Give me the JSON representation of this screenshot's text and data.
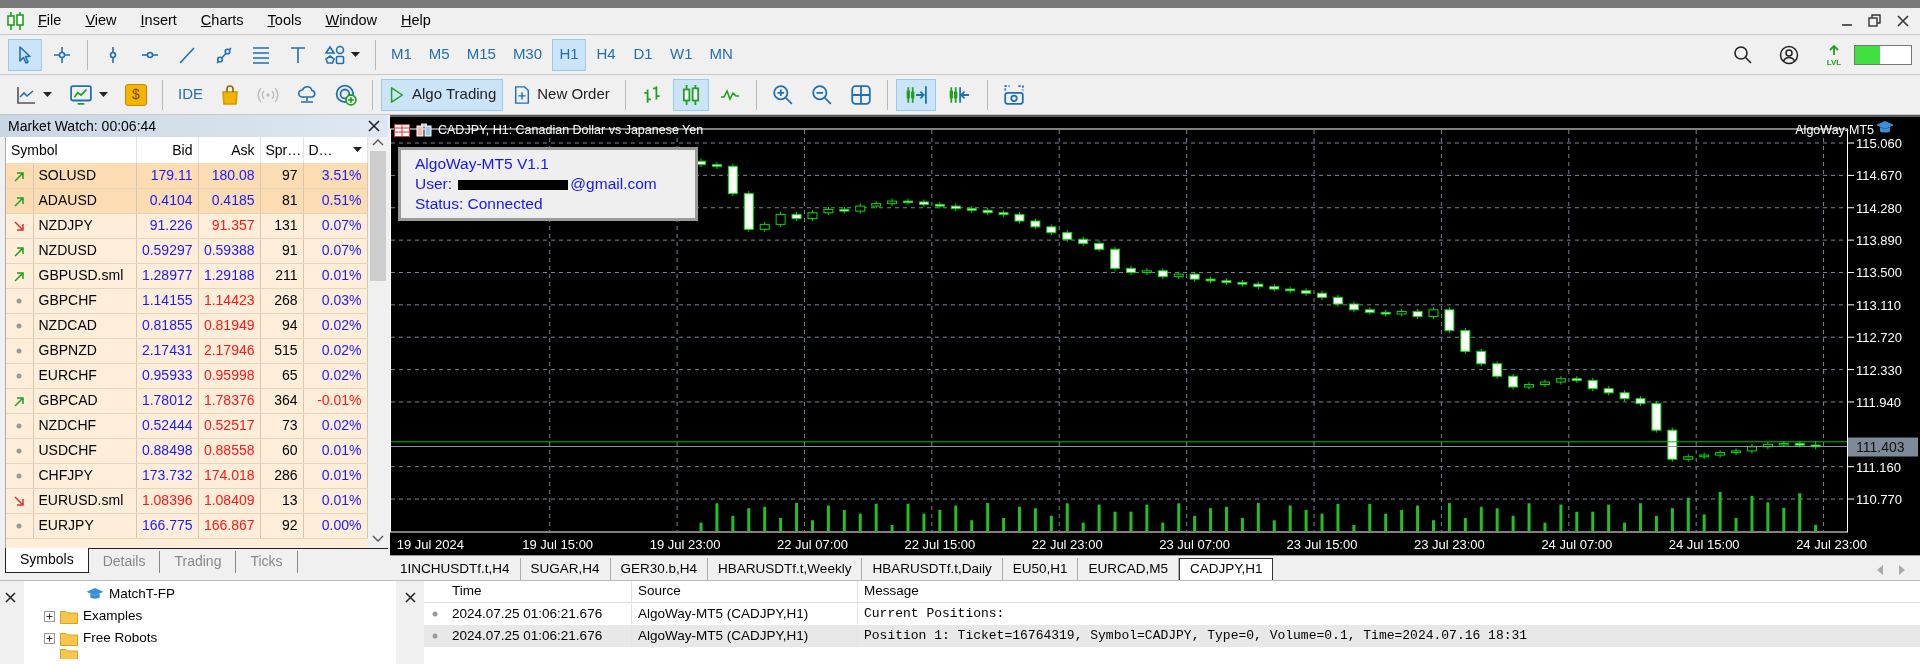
{
  "menu": [
    "File",
    "View",
    "Insert",
    "Charts",
    "Tools",
    "Window",
    "Help"
  ],
  "drawing_tools": [
    {
      "kind": "cursor",
      "selected": true
    },
    {
      "kind": "crosshair",
      "selected": false
    },
    {
      "kind": "vline",
      "selected": false
    },
    {
      "kind": "hline",
      "selected": false
    },
    {
      "kind": "trend",
      "selected": false
    },
    {
      "kind": "points",
      "selected": false
    },
    {
      "kind": "fibo",
      "selected": false
    },
    {
      "kind": "text",
      "selected": false
    },
    {
      "kind": "shapes",
      "selected": false
    }
  ],
  "timeframes": [
    {
      "label": "M1",
      "selected": false
    },
    {
      "label": "M5",
      "selected": false
    },
    {
      "label": "M15",
      "selected": false
    },
    {
      "label": "M30",
      "selected": false
    },
    {
      "label": "H1",
      "selected": true
    },
    {
      "label": "H4",
      "selected": false
    },
    {
      "label": "D1",
      "selected": false
    },
    {
      "label": "W1",
      "selected": false
    },
    {
      "label": "MN",
      "selected": false
    }
  ],
  "toolbar": [
    [
      {
        "kind": "linechart",
        "selected": false,
        "disabled": false
      },
      {
        "kind": "chartwin",
        "selected": false,
        "disabled": false
      },
      {
        "kind": "dollar",
        "label": "$",
        "selected": false,
        "disabled": false
      }
    ],
    [
      {
        "kind": "ide",
        "label": "IDE",
        "selected": false,
        "disabled": false
      },
      {
        "kind": "bag",
        "selected": false,
        "disabled": false
      },
      {
        "kind": "signal",
        "selected": false,
        "disabled": true
      },
      {
        "kind": "cloud",
        "selected": false,
        "disabled": false
      },
      {
        "kind": "globe",
        "selected": false,
        "disabled": false
      }
    ],
    [
      {
        "kind": "algo",
        "label": "Algo Trading",
        "selected": true,
        "disabled": false
      },
      {
        "kind": "order",
        "label": "New Order",
        "selected": false,
        "disabled": false
      }
    ],
    [
      {
        "kind": "bars",
        "selected": false,
        "disabled": false
      },
      {
        "kind": "candles",
        "selected": true,
        "disabled": false
      },
      {
        "kind": "line",
        "selected": false,
        "disabled": false
      }
    ],
    [
      {
        "kind": "zoomin",
        "selected": false,
        "disabled": false
      },
      {
        "kind": "zoomout",
        "selected": false,
        "disabled": false
      },
      {
        "kind": "grid",
        "selected": false,
        "disabled": false
      }
    ],
    [
      {
        "kind": "autoscroll",
        "selected": true,
        "disabled": false
      },
      {
        "kind": "shift",
        "selected": false,
        "disabled": false
      }
    ],
    [
      {
        "kind": "screenshot",
        "selected": false,
        "disabled": false
      }
    ]
  ],
  "level_meter": {
    "label": "LVL",
    "level": 0.45
  },
  "market_watch": {
    "title": "Market Watch: 00:06:44",
    "columns": [
      "Symbol",
      "Bid",
      "Ask",
      "Spr…",
      "D…"
    ],
    "rows": [
      {
        "kind": "up",
        "symbol": "SOLUSD",
        "bid": "179.11",
        "ask": "180.08",
        "spread": "97",
        "change": "3.51%",
        "bid_down": false,
        "ask_down": false,
        "change_negative": false,
        "highlighted": true
      },
      {
        "kind": "up",
        "symbol": "ADAUSD",
        "bid": "0.4104",
        "ask": "0.4185",
        "spread": "81",
        "change": "0.51%",
        "bid_down": false,
        "ask_down": false,
        "change_negative": false,
        "highlighted": true
      },
      {
        "kind": "down",
        "symbol": "NZDJPY",
        "bid": "91.226",
        "ask": "91.357",
        "spread": "131",
        "change": "0.07%",
        "bid_down": false,
        "ask_down": true,
        "change_negative": false,
        "highlighted": false
      },
      {
        "kind": "up",
        "symbol": "NZDUSD",
        "bid": "0.59297",
        "ask": "0.59388",
        "spread": "91",
        "change": "0.07%",
        "bid_down": false,
        "ask_down": false,
        "change_negative": false,
        "highlighted": false
      },
      {
        "kind": "up",
        "symbol": "GBPUSD.sml",
        "bid": "1.28977",
        "ask": "1.29188",
        "spread": "211",
        "change": "0.01%",
        "bid_down": false,
        "ask_down": false,
        "change_negative": false,
        "highlighted": false
      },
      {
        "kind": "flat",
        "symbol": "GBPCHF",
        "bid": "1.14155",
        "ask": "1.14423",
        "spread": "268",
        "change": "0.03%",
        "bid_down": false,
        "ask_down": true,
        "change_negative": false,
        "highlighted": false
      },
      {
        "kind": "flat",
        "symbol": "NZDCAD",
        "bid": "0.81855",
        "ask": "0.81949",
        "spread": "94",
        "change": "0.02%",
        "bid_down": false,
        "ask_down": true,
        "change_negative": false,
        "highlighted": false
      },
      {
        "kind": "flat",
        "symbol": "GBPNZD",
        "bid": "2.17431",
        "ask": "2.17946",
        "spread": "515",
        "change": "0.02%",
        "bid_down": false,
        "ask_down": true,
        "change_negative": false,
        "highlighted": false
      },
      {
        "kind": "flat",
        "symbol": "EURCHF",
        "bid": "0.95933",
        "ask": "0.95998",
        "spread": "65",
        "change": "0.02%",
        "bid_down": false,
        "ask_down": true,
        "change_negative": false,
        "highlighted": false
      },
      {
        "kind": "up",
        "symbol": "GBPCAD",
        "bid": "1.78012",
        "ask": "1.78376",
        "spread": "364",
        "change": "-0.01%",
        "bid_down": false,
        "ask_down": true,
        "change_negative": true,
        "highlighted": false
      },
      {
        "kind": "flat",
        "symbol": "NZDCHF",
        "bid": "0.52444",
        "ask": "0.52517",
        "spread": "73",
        "change": "0.02%",
        "bid_down": false,
        "ask_down": true,
        "change_negative": false,
        "highlighted": false
      },
      {
        "kind": "flat",
        "symbol": "USDCHF",
        "bid": "0.88498",
        "ask": "0.88558",
        "spread": "60",
        "change": "0.01%",
        "bid_down": false,
        "ask_down": true,
        "change_negative": false,
        "highlighted": false
      },
      {
        "kind": "flat",
        "symbol": "CHFJPY",
        "bid": "173.732",
        "ask": "174.018",
        "spread": "286",
        "change": "0.01%",
        "bid_down": false,
        "ask_down": true,
        "change_negative": false,
        "highlighted": false
      },
      {
        "kind": "down",
        "symbol": "EURUSD.sml",
        "bid": "1.08396",
        "ask": "1.08409",
        "spread": "13",
        "change": "0.01%",
        "bid_down": true,
        "ask_down": true,
        "change_negative": false,
        "highlighted": false
      },
      {
        "kind": "flat",
        "symbol": "EURJPY",
        "bid": "166.775",
        "ask": "166.867",
        "spread": "92",
        "change": "0.00%",
        "bid_down": false,
        "ask_down": true,
        "change_negative": false,
        "highlighted": false
      }
    ],
    "tabs": [
      {
        "label": "Symbols",
        "selected": true
      },
      {
        "label": "Details",
        "selected": false
      },
      {
        "label": "Trading",
        "selected": false
      },
      {
        "label": "Ticks",
        "selected": false
      }
    ]
  },
  "chart": {
    "header": "CADJPY, H1:  Canadian Dollar vs Japanese Yen",
    "ea_label": "AlgoWay-MT5",
    "info_box": {
      "title": "AlgoWay-MT5 V1.1",
      "user_label": "User:",
      "email_visible": "@gmail.com",
      "status": "Status: Connected"
    },
    "chart_data": {
      "type": "candlestick",
      "categories": [
        "19 Jul 2024",
        null,
        null,
        null,
        null,
        null,
        null,
        null,
        "19 Jul 15:00",
        null,
        null,
        null,
        null,
        null,
        null,
        null,
        "19 Jul 23:00",
        null,
        null,
        null,
        null,
        null,
        null,
        null,
        "22 Jul 07:00",
        null,
        null,
        null,
        null,
        null,
        null,
        null,
        "22 Jul 15:00",
        null,
        null,
        null,
        null,
        null,
        null,
        null,
        "22 Jul 23:00",
        null,
        null,
        null,
        null,
        null,
        null,
        null,
        "23 Jul 07:00",
        null,
        null,
        null,
        null,
        null,
        null,
        null,
        "23 Jul 15:00",
        null,
        null,
        null,
        null,
        null,
        null,
        null,
        "23 Jul 23:00",
        null,
        null,
        null,
        null,
        null,
        null,
        null,
        "24 Jul 07:00",
        null,
        null,
        null,
        null,
        null,
        null,
        null,
        "24 Jul 15:00",
        null,
        null,
        null,
        null,
        null,
        null,
        null,
        "24 Jul 23:00"
      ],
      "ohlc": [
        null,
        null,
        null,
        null,
        null,
        null,
        null,
        null,
        null,
        null,
        null,
        null,
        null,
        null,
        null,
        null,
        null,
        [
          114.84,
          114.87,
          114.77,
          114.8
        ],
        [
          114.8,
          114.83,
          114.75,
          114.78
        ],
        [
          114.78,
          114.81,
          114.42,
          114.45
        ],
        [
          114.45,
          114.48,
          113.99,
          114.02
        ],
        [
          114.02,
          114.11,
          113.99,
          114.08
        ],
        [
          114.08,
          114.23,
          114.05,
          114.2
        ],
        [
          114.2,
          114.23,
          114.12,
          114.15
        ],
        [
          114.15,
          114.25,
          114.12,
          114.22
        ],
        [
          114.22,
          114.29,
          114.19,
          114.26
        ],
        [
          114.26,
          114.29,
          114.21,
          114.24
        ],
        [
          114.24,
          114.33,
          114.21,
          114.3
        ],
        [
          114.3,
          114.36,
          114.27,
          114.33
        ],
        [
          114.33,
          114.39,
          114.3,
          114.36
        ],
        [
          114.36,
          114.39,
          114.32,
          114.35
        ],
        [
          114.35,
          114.38,
          114.29,
          114.32
        ],
        [
          114.32,
          114.35,
          114.27,
          114.3
        ],
        [
          114.3,
          114.33,
          114.24,
          114.27
        ],
        [
          114.27,
          114.3,
          114.22,
          114.25
        ],
        [
          114.25,
          114.28,
          114.19,
          114.22
        ],
        [
          114.22,
          114.25,
          114.17,
          114.2
        ],
        [
          114.2,
          114.23,
          114.09,
          114.12
        ],
        [
          114.12,
          114.15,
          114.02,
          114.05
        ],
        [
          114.05,
          114.08,
          113.95,
          113.98
        ],
        [
          113.98,
          114.01,
          113.87,
          113.9
        ],
        [
          113.9,
          113.93,
          113.82,
          113.85
        ],
        [
          113.85,
          113.88,
          113.75,
          113.78
        ],
        [
          113.78,
          113.81,
          113.52,
          113.55
        ],
        [
          113.55,
          113.58,
          113.47,
          113.5
        ],
        [
          113.5,
          113.55,
          113.47,
          113.52
        ],
        [
          113.52,
          113.55,
          113.42,
          113.45
        ],
        [
          113.45,
          113.51,
          113.42,
          113.48
        ],
        [
          113.48,
          113.51,
          113.39,
          113.42
        ],
        [
          113.42,
          113.45,
          113.37,
          113.4
        ],
        [
          113.4,
          113.43,
          113.35,
          113.38
        ],
        [
          113.38,
          113.41,
          113.33,
          113.36
        ],
        [
          113.36,
          113.39,
          113.3,
          113.33
        ],
        [
          113.33,
          113.36,
          113.27,
          113.3
        ],
        [
          113.3,
          113.33,
          113.25,
          113.28
        ],
        [
          113.28,
          113.31,
          113.22,
          113.25
        ],
        [
          113.25,
          113.28,
          113.17,
          113.2
        ],
        [
          113.2,
          113.23,
          113.09,
          113.12
        ],
        [
          113.12,
          113.15,
          113.02,
          113.05
        ],
        [
          113.05,
          113.08,
          112.99,
          113.02
        ],
        [
          113.02,
          113.05,
          112.97,
          113.0
        ],
        [
          113.0,
          113.06,
          112.97,
          113.03
        ],
        [
          113.03,
          113.06,
          112.94,
          112.97
        ],
        [
          112.97,
          113.08,
          112.94,
          113.05
        ],
        [
          113.05,
          113.08,
          112.77,
          112.8
        ],
        [
          112.8,
          112.83,
          112.52,
          112.55
        ],
        [
          112.55,
          112.58,
          112.37,
          112.4
        ],
        [
          112.4,
          112.43,
          112.22,
          112.25
        ],
        [
          112.25,
          112.28,
          112.09,
          112.12
        ],
        [
          112.12,
          112.18,
          112.09,
          112.15
        ],
        [
          112.15,
          112.21,
          112.12,
          112.18
        ],
        [
          112.18,
          112.25,
          112.15,
          112.22
        ],
        [
          112.22,
          112.25,
          112.17,
          112.2
        ],
        [
          112.2,
          112.23,
          112.07,
          112.1
        ],
        [
          112.1,
          112.13,
          112.02,
          112.05
        ],
        [
          112.05,
          112.08,
          111.95,
          111.98
        ],
        [
          111.98,
          112.01,
          111.89,
          111.92
        ],
        [
          111.92,
          111.95,
          111.57,
          111.6
        ],
        [
          111.6,
          111.63,
          111.22,
          111.25
        ],
        [
          111.25,
          111.31,
          111.22,
          111.28
        ],
        [
          111.28,
          111.33,
          111.25,
          111.3
        ],
        [
          111.3,
          111.36,
          111.27,
          111.33
        ],
        [
          111.33,
          111.38,
          111.3,
          111.35
        ],
        [
          111.35,
          111.43,
          111.32,
          111.4
        ],
        [
          111.4,
          111.46,
          111.37,
          111.43
        ],
        [
          111.43,
          111.47,
          111.4,
          111.44
        ],
        [
          111.44,
          111.47,
          111.39,
          111.42
        ],
        [
          111.42,
          111.47,
          111.37,
          111.4
        ],
        null
      ],
      "ylim": [
        110.373,
        115.229
      ],
      "grid": true,
      "ref_lines": [
        {
          "axis": "y",
          "value": 111.46,
          "color": "#00c000"
        },
        {
          "axis": "y",
          "value": 111.403,
          "label": "111.403",
          "color": "#8a96a3"
        }
      ],
      "yticks": [
        {
          "value": 115.06,
          "label": "115.060"
        },
        {
          "value": 114.67,
          "label": "114.670"
        },
        {
          "value": 114.28,
          "label": "114.280"
        },
        {
          "value": 113.89,
          "label": "113.890"
        },
        {
          "value": 113.5,
          "label": "113.500"
        },
        {
          "value": 113.11,
          "label": "113.110"
        },
        {
          "value": 112.72,
          "label": "112.720"
        },
        {
          "value": 112.33,
          "label": "112.330"
        },
        {
          "value": 111.94,
          "label": "111.940"
        },
        {
          "value": 111.16,
          "label": "111.160"
        },
        {
          "value": 110.77,
          "label": "110.770"
        }
      ]
    }
  },
  "chart_tabs": [
    {
      "label": "1INCHUSDTf.t,H4",
      "selected": false
    },
    {
      "label": "SUGAR,H4",
      "selected": false
    },
    {
      "label": "GER30.b,H4",
      "selected": false
    },
    {
      "label": "HBARUSDTf.t,Weekly",
      "selected": false
    },
    {
      "label": "HBARUSDTf.t,Daily",
      "selected": false
    },
    {
      "label": "EU50,H1",
      "selected": false
    },
    {
      "label": "EURCAD,M5",
      "selected": false
    },
    {
      "label": "CADJPY,H1",
      "selected": true
    }
  ],
  "navigator": {
    "items": [
      {
        "children": [
          {
            "label": "MatchT-FP",
            "kind": "program"
          }
        ]
      },
      {
        "label": "Examples",
        "kind": "folder",
        "expanded": false
      },
      {
        "label": "Free Robots",
        "kind": "folder",
        "expanded": false
      }
    ]
  },
  "log": {
    "columns": [
      "Time",
      "Source",
      "Message"
    ],
    "rows": [
      {
        "time": "2024.07.25 01:06:21.676",
        "source": "AlgoWay-MT5 (CADJPY,H1)",
        "message": "Current Positions:",
        "selected": false
      },
      {
        "time": "2024.07.25 01:06:21.676",
        "source": "AlgoWay-MT5 (CADJPY,H1)",
        "message": "Position 1: Ticket=16764319, Symbol=CADJPY, Type=0, Volume=0.1, Time=2024.07.16 18:31",
        "selected": true
      }
    ]
  }
}
